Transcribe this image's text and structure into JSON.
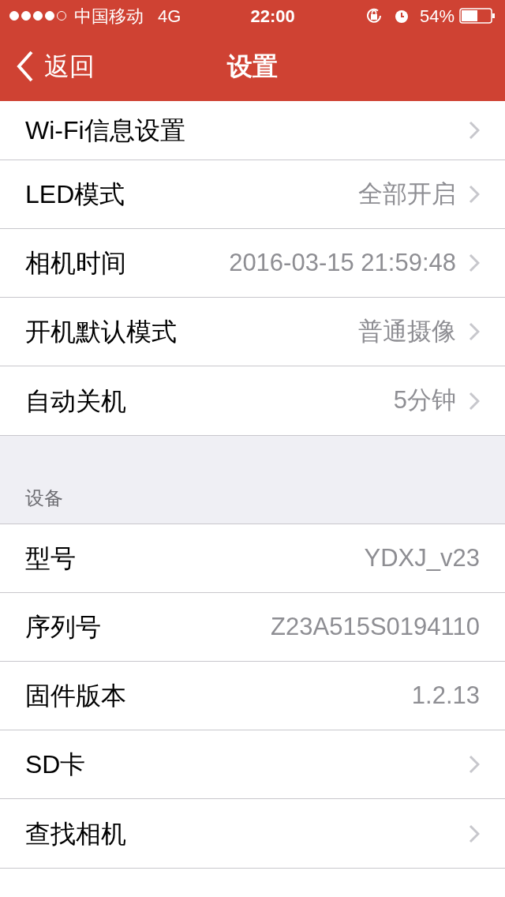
{
  "status_bar": {
    "carrier": "中国移动",
    "network": "4G",
    "time": "22:00",
    "battery": "54%"
  },
  "nav": {
    "back": "返回",
    "title": "设置"
  },
  "sections": [
    {
      "rows": [
        {
          "label": "Wi-Fi信息设置",
          "chevron": true
        },
        {
          "label": "LED模式",
          "value": "全部开启",
          "chevron": true
        },
        {
          "label": "相机时间",
          "value": "2016-03-15 21:59:48",
          "chevron": true
        },
        {
          "label": "开机默认模式",
          "value": "普通摄像",
          "chevron": true
        },
        {
          "label": "自动关机",
          "value": "5分钟",
          "chevron": true
        }
      ]
    },
    {
      "header": "设备",
      "rows": [
        {
          "label": "型号",
          "value": "YDXJ_v23",
          "chevron": false
        },
        {
          "label": "序列号",
          "value": "Z23A515S0194110",
          "chevron": false
        },
        {
          "label": "固件版本",
          "value": "1.2.13",
          "chevron": false
        },
        {
          "label": "SD卡",
          "chevron": true
        },
        {
          "label": "查找相机",
          "chevron": true
        }
      ]
    }
  ]
}
